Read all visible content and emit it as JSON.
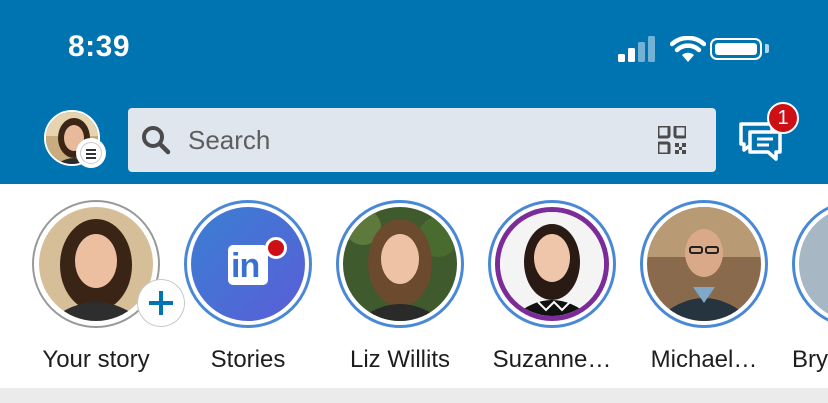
{
  "colors": {
    "brand": "#0073b1",
    "badge": "#cc1016",
    "story_ring": "#4a88d6",
    "seen_ring": "#999999",
    "purple_ring": "#7b2c98"
  },
  "status_bar": {
    "time": "8:39",
    "icons": [
      "cellular-signal-icon",
      "wifi-icon",
      "battery-icon"
    ]
  },
  "header": {
    "search": {
      "placeholder": "Search",
      "value": ""
    },
    "messaging_badge_count": "1",
    "icons": [
      "profile-avatar",
      "menu-icon",
      "search-icon",
      "qr-code-icon",
      "messaging-icon"
    ]
  },
  "stories": [
    {
      "label": "Your story",
      "kind": "own"
    },
    {
      "label": "Stories",
      "kind": "linkedin"
    },
    {
      "label": "Liz Willits",
      "kind": "person"
    },
    {
      "label": "Suzanne…",
      "kind": "person"
    },
    {
      "label": "Michael…",
      "kind": "person"
    },
    {
      "label": "Bry",
      "kind": "person"
    }
  ]
}
